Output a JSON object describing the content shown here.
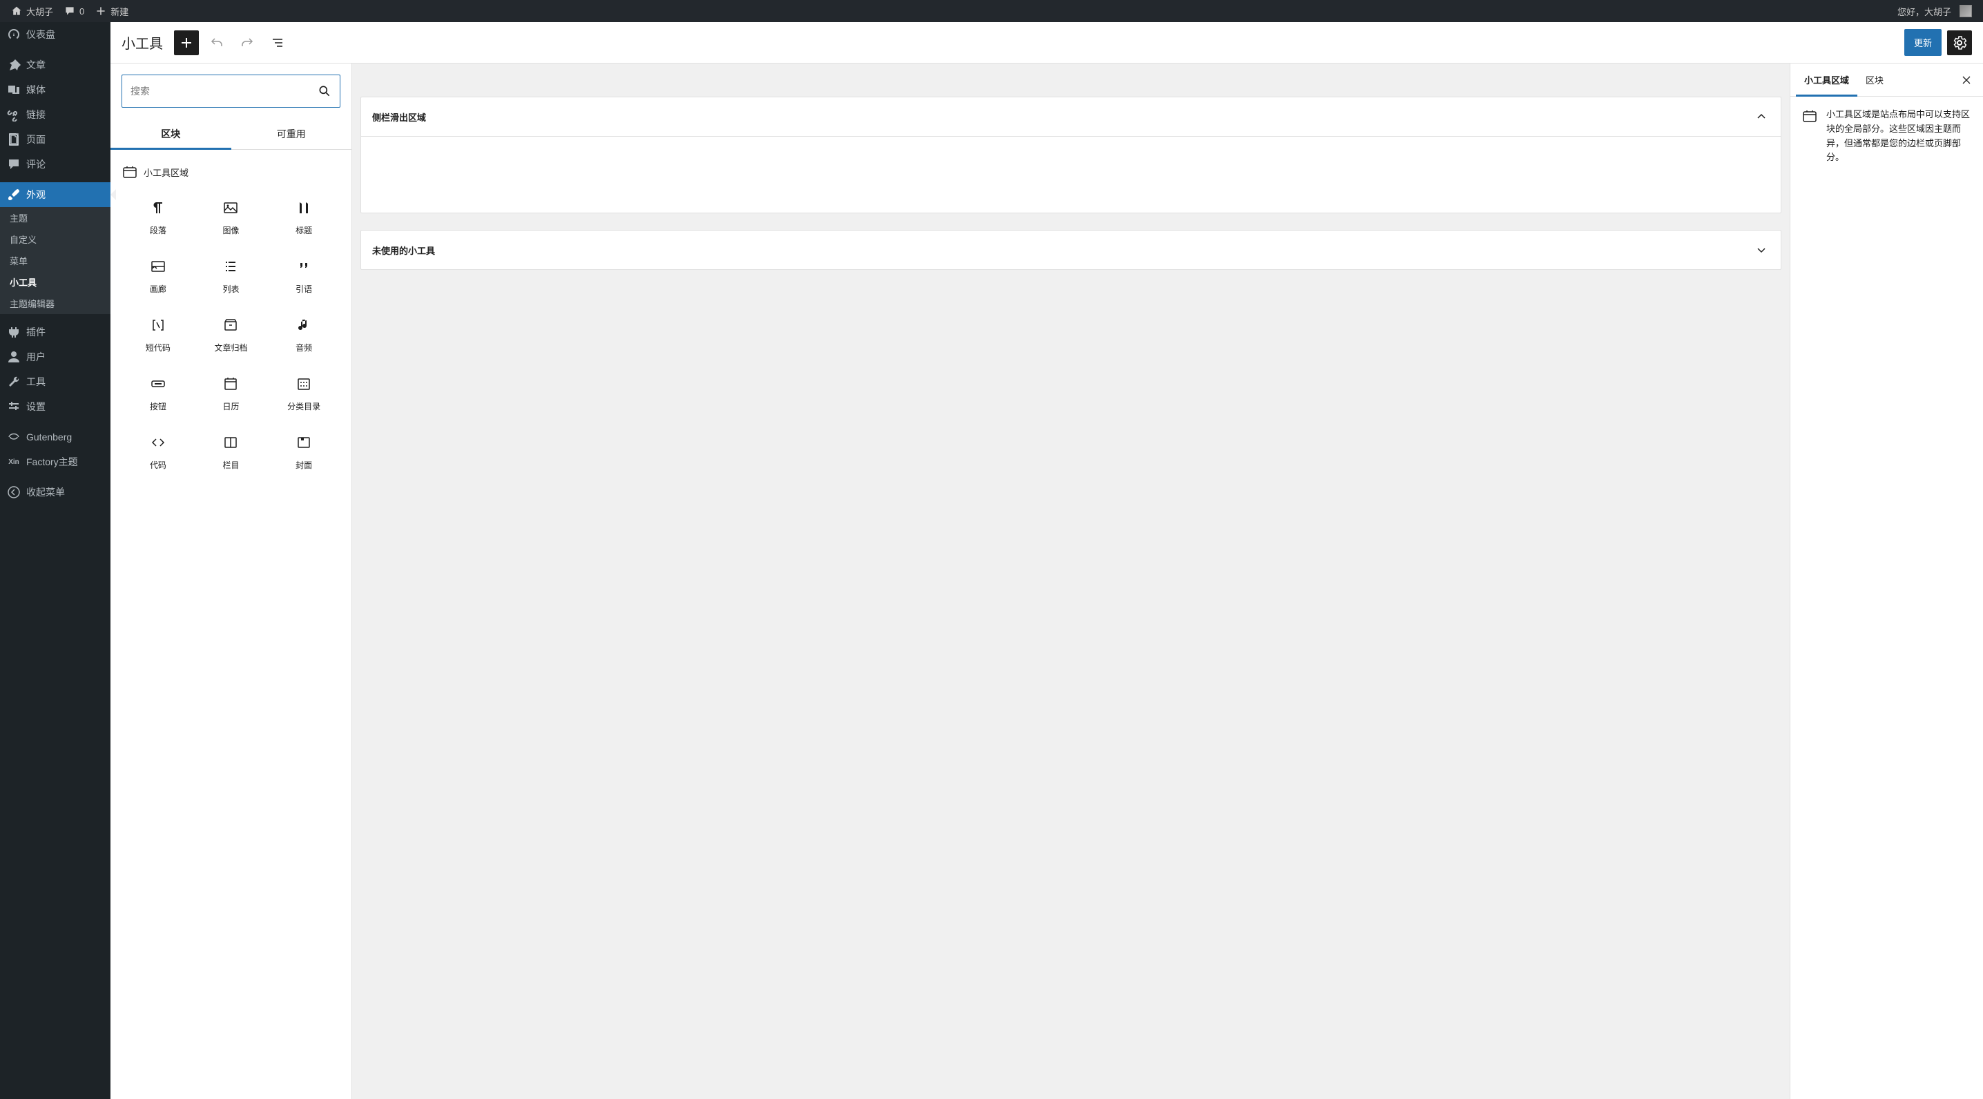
{
  "adminbar": {
    "site_name": "大胡子",
    "comments_count": "0",
    "new_label": "新建",
    "greeting": "您好，大胡子"
  },
  "adminmenu": {
    "dashboard": "仪表盘",
    "posts": "文章",
    "media": "媒体",
    "links": "链接",
    "pages": "页面",
    "comments": "评论",
    "appearance": "外观",
    "appearance_sub": {
      "themes": "主题",
      "customize": "自定义",
      "menus": "菜单",
      "widgets": "小工具",
      "theme_editor": "主题编辑器"
    },
    "plugins": "插件",
    "users": "用户",
    "tools": "工具",
    "settings": "设置",
    "gutenberg": "Gutenberg",
    "factory": "Factory主题",
    "collapse": "收起菜单"
  },
  "editor": {
    "page_title": "小工具",
    "update_button": "更新"
  },
  "inserter": {
    "search_placeholder": "搜索",
    "tabs": {
      "blocks": "区块",
      "reusable": "可重用"
    },
    "category": "小工具区域",
    "blocks": [
      {
        "id": "paragraph",
        "label": "段落"
      },
      {
        "id": "image",
        "label": "图像"
      },
      {
        "id": "heading",
        "label": "标题"
      },
      {
        "id": "gallery",
        "label": "画廊"
      },
      {
        "id": "list",
        "label": "列表"
      },
      {
        "id": "quote",
        "label": "引语"
      },
      {
        "id": "shortcode",
        "label": "短代码"
      },
      {
        "id": "archives",
        "label": "文章归档"
      },
      {
        "id": "audio",
        "label": "音频"
      },
      {
        "id": "button",
        "label": "按钮"
      },
      {
        "id": "calendar",
        "label": "日历"
      },
      {
        "id": "categories",
        "label": "分类目录"
      },
      {
        "id": "code",
        "label": "代码"
      },
      {
        "id": "columns",
        "label": "栏目"
      },
      {
        "id": "cover",
        "label": "封面"
      }
    ]
  },
  "canvas": {
    "area1_title": "侧栏滑出区域",
    "area2_title": "未使用的小工具"
  },
  "settings_panel": {
    "tab1": "小工具区域",
    "tab2": "区块",
    "description": "小工具区域是站点布局中可以支持区块的全局部分。这些区域因主题而异，但通常都是您的边栏或页脚部分。"
  }
}
